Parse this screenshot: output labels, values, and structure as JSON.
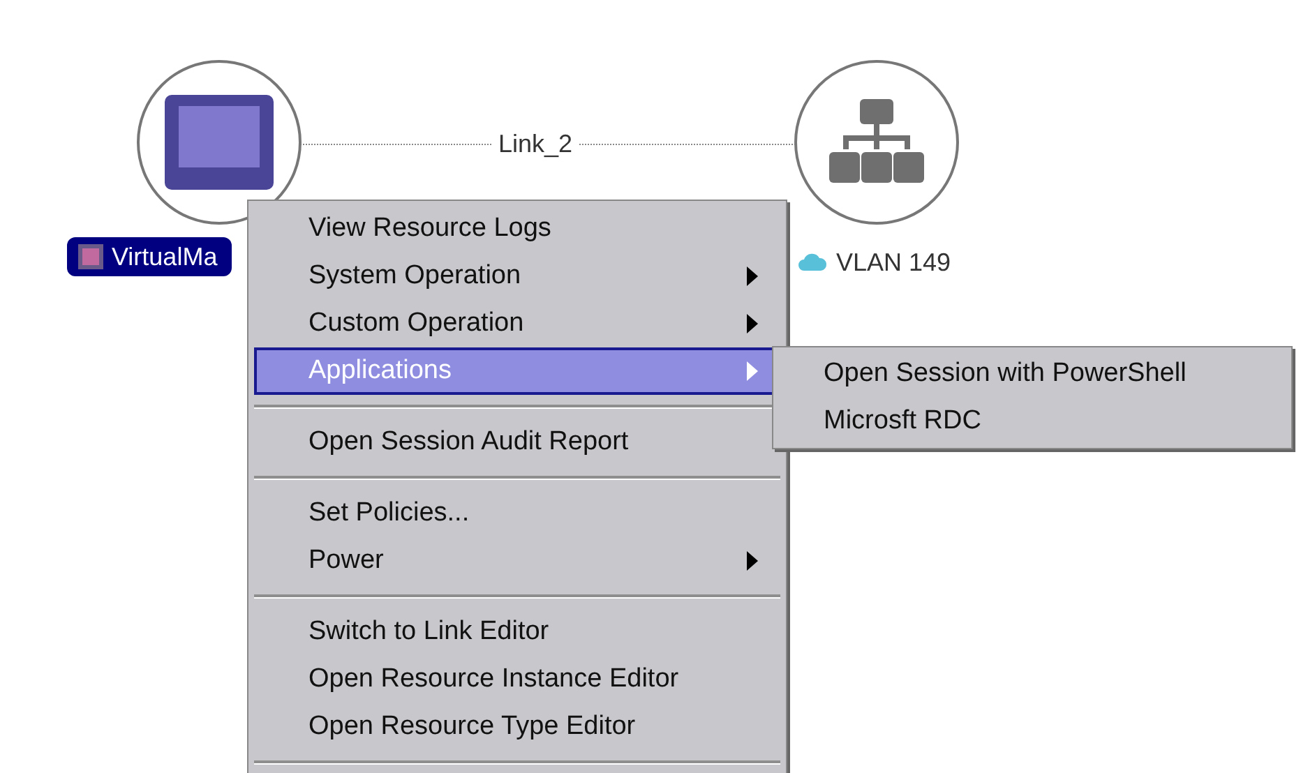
{
  "nodes": [
    {
      "kind": "virtual_machine",
      "label": "VirtualMa",
      "selected": true
    },
    {
      "kind": "network",
      "label": "VLAN 149",
      "selected": false
    }
  ],
  "link": {
    "label": "Link_2"
  },
  "context_menu": {
    "items": [
      {
        "kind": "item",
        "label": "View Resource Logs",
        "submenu": false,
        "selected": false
      },
      {
        "kind": "item",
        "label": "System Operation",
        "submenu": true,
        "selected": false
      },
      {
        "kind": "item",
        "label": "Custom Operation",
        "submenu": true,
        "selected": false
      },
      {
        "kind": "item",
        "label": "Applications",
        "submenu": true,
        "selected": true
      },
      {
        "kind": "separator"
      },
      {
        "kind": "item",
        "label": "Open Session Audit Report",
        "submenu": false,
        "selected": false
      },
      {
        "kind": "separator"
      },
      {
        "kind": "item",
        "label": "Set Policies...",
        "submenu": false,
        "selected": false
      },
      {
        "kind": "item",
        "label": "Power",
        "submenu": true,
        "selected": false
      },
      {
        "kind": "separator"
      },
      {
        "kind": "item",
        "label": "Switch to Link Editor",
        "submenu": false,
        "selected": false
      },
      {
        "kind": "item",
        "label": "Open Resource Instance Editor",
        "submenu": false,
        "selected": false
      },
      {
        "kind": "item",
        "label": "Open Resource Type Editor",
        "submenu": false,
        "selected": false
      },
      {
        "kind": "separator"
      }
    ]
  },
  "submenu": {
    "items": [
      {
        "label": "Open Session with PowerShell",
        "selected": false
      },
      {
        "label": "Microsft RDC",
        "selected": false
      }
    ]
  }
}
